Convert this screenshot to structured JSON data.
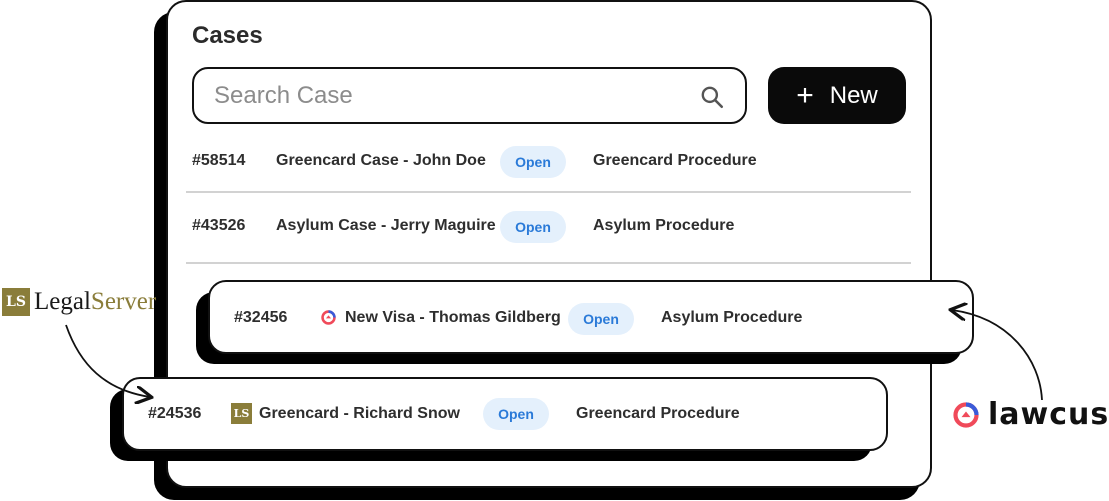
{
  "panel": {
    "title": "Cases",
    "search": {
      "placeholder": "Search Case",
      "value": ""
    },
    "new_button": {
      "icon": "plus-icon",
      "label": "New"
    },
    "rows": [
      {
        "id": "#58514",
        "name": "Greencard Case - John Doe",
        "status": "Open",
        "procedure": "Greencard Procedure"
      },
      {
        "id": "#43526",
        "name": "Asylum Case - Jerry Maguire",
        "status": "Open",
        "procedure": "Asylum Procedure"
      }
    ]
  },
  "floating_rows": [
    {
      "id": "#32456",
      "source_icon": "lawcus-icon",
      "name": "New Visa - Thomas Gildberg",
      "status": "Open",
      "procedure": "Asylum Procedure"
    },
    {
      "id": "#24536",
      "source_icon": "legalserver-icon",
      "name": "Greencard - Richard Snow",
      "status": "Open",
      "procedure": "Greencard Procedure"
    }
  ],
  "logos": {
    "legalserver": {
      "mark": "LS",
      "text_part1": "Legal",
      "text_part2": "Server"
    },
    "lawcus": {
      "text": "lawcus"
    }
  },
  "colors": {
    "badge_bg": "#e4f0fc",
    "badge_text": "#2a7ad8",
    "legalserver_gold": "#8a7d3a",
    "lawcus_red": "#f04a5a",
    "lawcus_blue": "#3a5bd9"
  }
}
